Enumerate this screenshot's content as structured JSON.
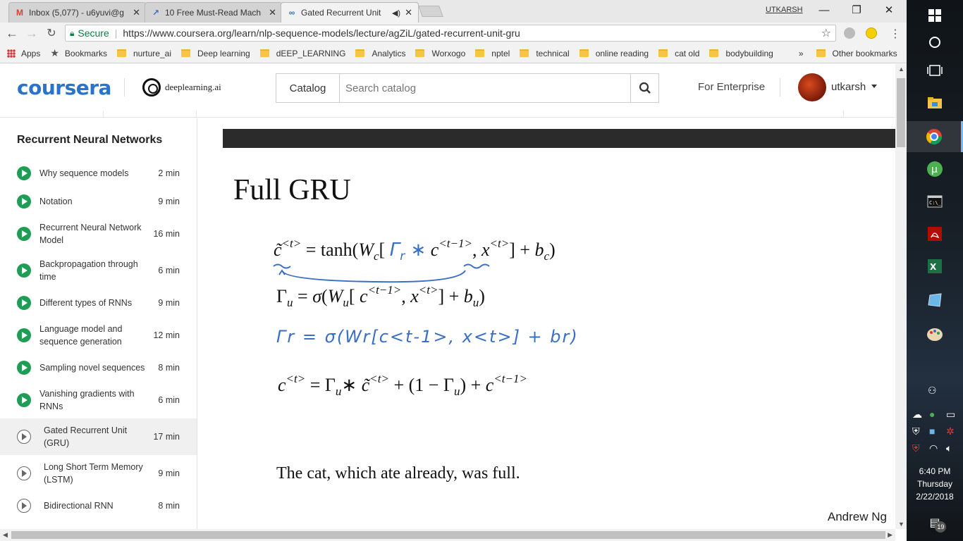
{
  "browser": {
    "tabs": [
      {
        "title": "Inbox (5,077) - u6yuvi@g",
        "icon": "gmail-icon"
      },
      {
        "title": "10 Free Must-Read Mach",
        "icon": "chart-icon"
      },
      {
        "title": "Gated Recurrent Unit",
        "icon": "coursera-icon"
      }
    ],
    "profile": "UTKARSH",
    "secure_label": "Secure",
    "url": "https://www.coursera.org/learn/nlp-sequence-models/lecture/agZiL/gated-recurrent-unit-gru",
    "bookmarks": [
      {
        "label": "Apps",
        "type": "apps"
      },
      {
        "label": "Bookmarks",
        "type": "star"
      },
      {
        "label": "nurture_ai",
        "type": "folder"
      },
      {
        "label": "Deep learning",
        "type": "folder"
      },
      {
        "label": "dEEP_LEARNING",
        "type": "folder"
      },
      {
        "label": "Analytics",
        "type": "folder"
      },
      {
        "label": "Worxogo",
        "type": "folder"
      },
      {
        "label": "nptel",
        "type": "folder"
      },
      {
        "label": "technical",
        "type": "folder"
      },
      {
        "label": "online reading",
        "type": "folder"
      },
      {
        "label": "cat old",
        "type": "folder"
      },
      {
        "label": "bodybuilding",
        "type": "folder"
      }
    ],
    "more_label": "»",
    "other_bookmarks": "Other bookmarks"
  },
  "header": {
    "logo": "coursera",
    "partner": "deeplearning.ai",
    "catalog_label": "Catalog",
    "search_placeholder": "Search catalog",
    "enterprise_label": "For Enterprise",
    "username": "utkarsh"
  },
  "sidebar": {
    "title": "Recurrent Neural Networks",
    "items": [
      {
        "label": "Why sequence models",
        "duration": "2 min",
        "watched": true
      },
      {
        "label": "Notation",
        "duration": "9 min",
        "watched": true
      },
      {
        "label": "Recurrent Neural Network Model",
        "duration": "16 min",
        "watched": true
      },
      {
        "label": "Backpropagation through time",
        "duration": "6 min",
        "watched": true
      },
      {
        "label": "Different types of RNNs",
        "duration": "9 min",
        "watched": true
      },
      {
        "label": "Language model and sequence generation",
        "duration": "12 min",
        "watched": true
      },
      {
        "label": "Sampling novel sequences",
        "duration": "8 min",
        "watched": true
      },
      {
        "label": "Vanishing gradients with RNNs",
        "duration": "6 min",
        "watched": true
      },
      {
        "label": "Gated Recurrent Unit (GRU)",
        "duration": "17 min",
        "watched": false
      },
      {
        "label": "Long Short Term Memory (LSTM)",
        "duration": "9 min",
        "watched": false
      },
      {
        "label": "Bidirectional RNN",
        "duration": "8 min",
        "watched": false
      }
    ]
  },
  "slide": {
    "title": "Full GRU",
    "handwritten_gamma_r": "Γr = σ(Wr[c<t-1>, x<t>] + br)",
    "sentence": "The cat, which ate already, was full.",
    "author": "Andrew Ng"
  },
  "taskbar": {
    "time": "6:40 PM",
    "day": "Thursday",
    "date": "2/22/2018",
    "notifications": "19"
  },
  "colors": {
    "coursera_blue": "#2a73cc",
    "watched_green": "#1f9d55",
    "secure_green": "#0b8043",
    "handwriting_blue": "#3a6fc4"
  }
}
